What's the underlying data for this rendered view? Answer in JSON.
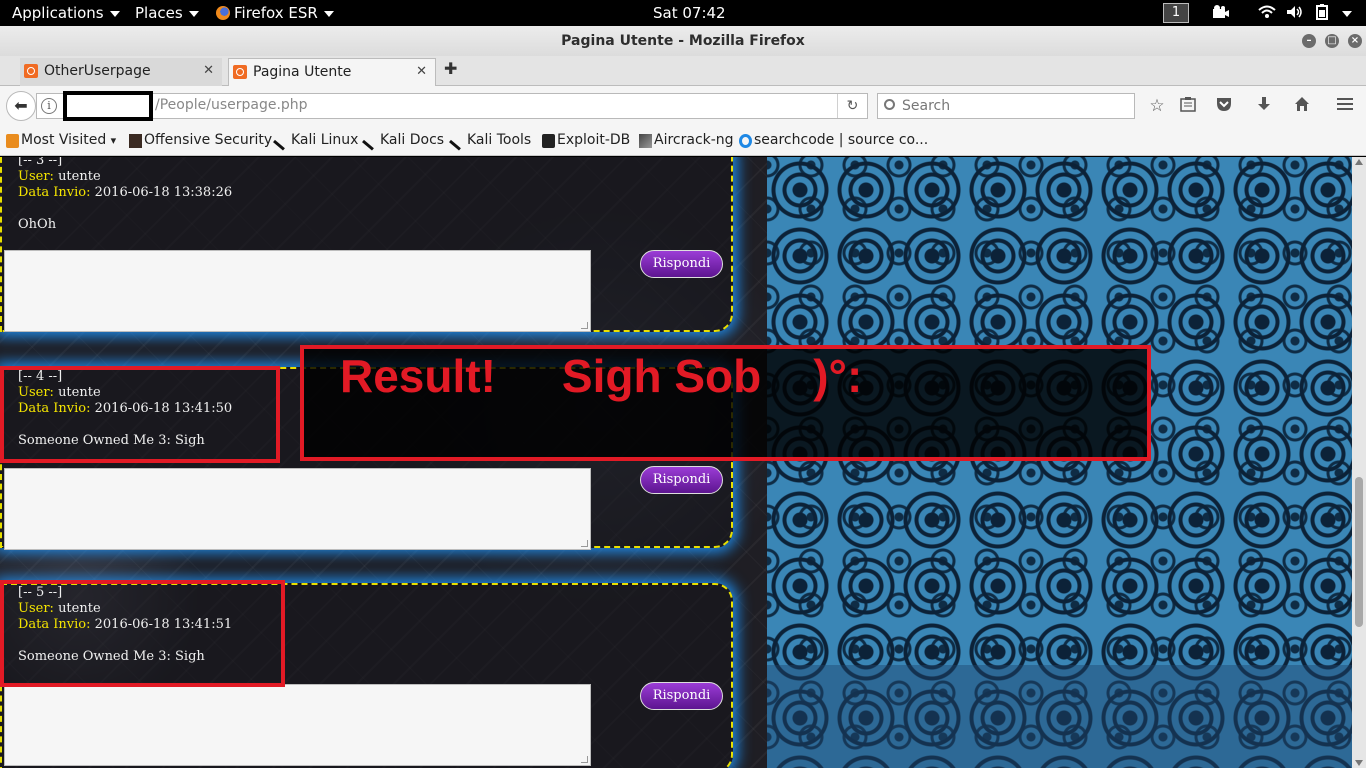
{
  "system_bar": {
    "applications": "Applications",
    "places": "Places",
    "firefox": "Firefox ESR",
    "clock": "Sat 07:42",
    "workspace": "1"
  },
  "window": {
    "title": "Pagina Utente - Mozilla Firefox"
  },
  "tabs": [
    {
      "label": "OtherUserpage",
      "active": false
    },
    {
      "label": "Pagina Utente",
      "active": true
    }
  ],
  "nav": {
    "url_path": "/People/userpage.php",
    "search_placeholder": "Search"
  },
  "bookmarks": [
    {
      "label": "Most Visited",
      "icon": "gear-icon"
    },
    {
      "label": "Offensive Security",
      "icon": "offsec-icon"
    },
    {
      "label": "Kali Linux",
      "icon": "kali-icon"
    },
    {
      "label": "Kali Docs",
      "icon": "kali-icon"
    },
    {
      "label": "Kali Tools",
      "icon": "kali-icon"
    },
    {
      "label": "Exploit-DB",
      "icon": "exploitdb-icon"
    },
    {
      "label": "Aircrack-ng",
      "icon": "aircrack-icon"
    },
    {
      "label": "searchcode | source co...",
      "icon": "searchcode-icon"
    }
  ],
  "posts": [
    {
      "number": "[-- 3 --]",
      "user_label": "User:",
      "user": "utente",
      "date_label": "Data Invio:",
      "date": "2016-06-18 13:38:26",
      "message": "OhOh",
      "reply_label": "Rispondi"
    },
    {
      "number": "[-- 4 --]",
      "user_label": "User:",
      "user": "utente",
      "date_label": "Data Invio:",
      "date": "2016-06-18 13:41:50",
      "message": "Someone Owned Me 3: Sigh",
      "reply_label": "Rispondi"
    },
    {
      "number": "[-- 5 --]",
      "user_label": "User:",
      "user": "utente",
      "date_label": "Data Invio:",
      "date": "2016-06-18 13:41:51",
      "message": "Someone Owned Me 3: Sigh",
      "reply_label": "Rispondi"
    }
  ],
  "annotation": {
    "part1": "Result!",
    "part2": "Sigh Sob",
    "part3": ")°:",
    "color": "#e21a25"
  }
}
